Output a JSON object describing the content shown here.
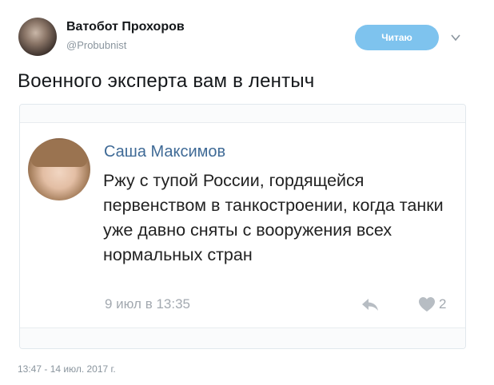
{
  "author": {
    "name": "Ватобот Прохоров",
    "handle": "@Probubnist"
  },
  "follow_button": {
    "label": "Читаю"
  },
  "tweet": {
    "text": "Военного эксперта вам в лентыч",
    "timestamp": "13:47 - 14 июл. 2017 г."
  },
  "embedded_post": {
    "author_name": "Саша Максимов",
    "text": "Ржу с тупой России, гордящейся первенством в танкостроении, когда танки уже давно сняты с вооружения всех нормальных стран",
    "date": "9 июл в 13:35",
    "likes": "2"
  },
  "icons": {
    "follow_menu": "chevron-down-icon",
    "share": "share-icon",
    "like": "heart-icon"
  },
  "colors": {
    "follow_button_bg": "#7ec3ee",
    "vk_name": "#3f6a96",
    "muted": "#a3a9b0"
  }
}
